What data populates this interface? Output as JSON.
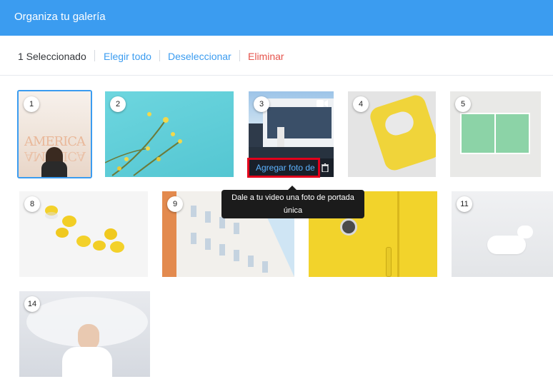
{
  "header": {
    "title": "Organiza tu galería"
  },
  "toolbar": {
    "selected_count": "1 Seleccionado",
    "select_all": "Elegir todo",
    "deselect": "Deseleccionar",
    "delete": "Eliminar"
  },
  "gallery": {
    "items": [
      {
        "num": "1",
        "content": "AMERICA"
      },
      {
        "num": "2"
      },
      {
        "num": "3",
        "overlay_label": "Agregar foto de"
      },
      {
        "num": "4"
      },
      {
        "num": "5"
      },
      {
        "num": "8"
      },
      {
        "num": "9"
      },
      {
        "num": "11"
      },
      {
        "num": "14"
      }
    ]
  },
  "tooltip": {
    "text": "Dale a tu video una foto de portada única"
  },
  "colors": {
    "accent": "#3b9cf0",
    "delete": "#e5534b",
    "selection": "#3b9cf0",
    "highlight": "#e3001b"
  }
}
